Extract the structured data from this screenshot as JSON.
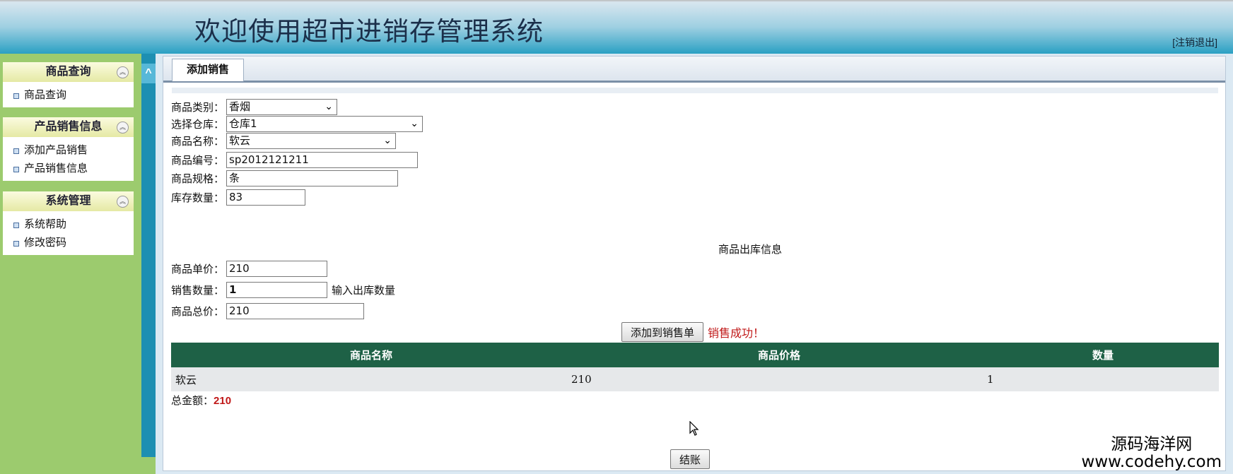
{
  "header": {
    "title": "欢迎使用超市进销存管理系统",
    "logout_label": "[注销退出]"
  },
  "sidebar": {
    "collapse_arrow": "^",
    "panels": [
      {
        "title": "商品查询",
        "items": [
          {
            "label": "商品查询"
          }
        ]
      },
      {
        "title": "产品销售信息",
        "items": [
          {
            "label": "添加产品销售"
          },
          {
            "label": "产品销售信息"
          }
        ]
      },
      {
        "title": "系统管理",
        "items": [
          {
            "label": "系统帮助"
          },
          {
            "label": "修改密码"
          }
        ]
      }
    ]
  },
  "main": {
    "tab_label": "添加销售",
    "form": {
      "category_label": "商品类别：",
      "category_value": "香烟",
      "warehouse_label": "选择仓库：",
      "warehouse_value": "仓库1",
      "product_name_label": "商品名称：",
      "product_name_value": "软云",
      "product_code_label": "商品编号：",
      "product_code_value": "sp2012121211",
      "spec_label": "商品规格：",
      "spec_value": "条",
      "stock_label": "库存数量：",
      "stock_value": "83"
    },
    "outbound_title": "商品出库信息",
    "outbound": {
      "unit_price_label": "商品单价：",
      "unit_price_value": "210",
      "quantity_label": "销售数量：",
      "quantity_value": "1",
      "quantity_hint": "输入出库数量",
      "total_price_label": "商品总价：",
      "total_price_value": "210"
    },
    "add_button_label": "添加到销售单",
    "status_message": "销售成功！",
    "table": {
      "headers": [
        "商品名称",
        "商品价格",
        "数量"
      ],
      "rows": [
        [
          "软云",
          "210",
          "1"
        ]
      ]
    },
    "total_label": "总金额：",
    "total_value": "210",
    "checkout_label": "结账"
  },
  "watermark": {
    "line1": "源码海洋网",
    "line2": "www.codehy.com"
  },
  "colors": {
    "table_header": "#1e6146",
    "status_red": "#c01818",
    "sidebar_green": "#9ccb6e",
    "splitter_blue": "#1d8fb2"
  }
}
